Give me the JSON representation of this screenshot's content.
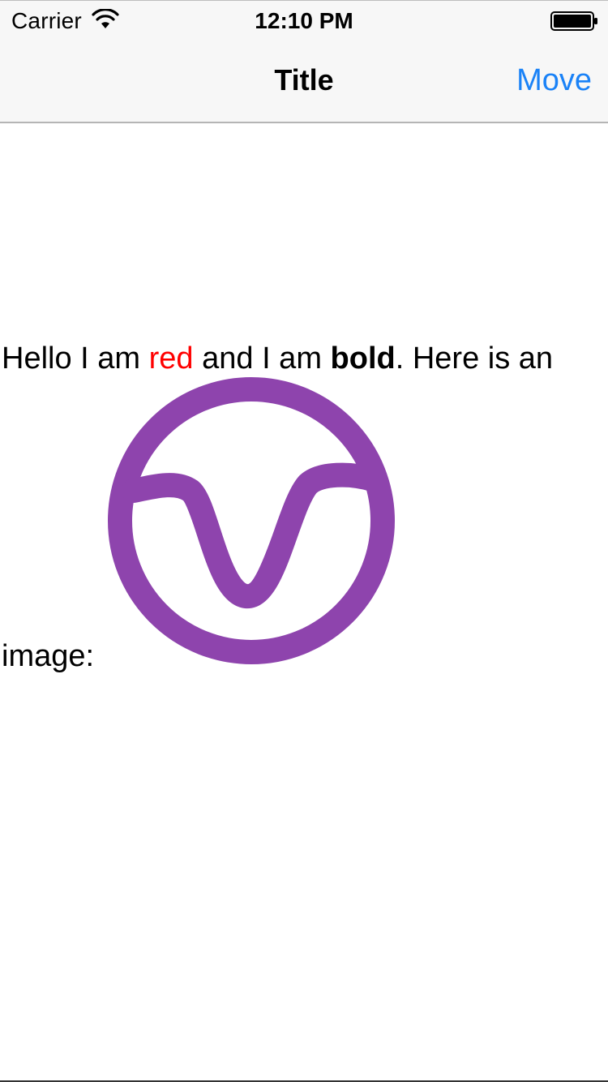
{
  "status_bar": {
    "carrier": "Carrier",
    "time": "12:10 PM",
    "wifi_icon": "wifi-icon",
    "battery_icon": "battery-icon"
  },
  "nav_bar": {
    "title": "Title",
    "right_button": "Move",
    "accent_color": "#1a82f7"
  },
  "body_text": {
    "part1": "Hello I am ",
    "red": "red",
    "part2": " and I am ",
    "bold": "bold",
    "part3": ". Here is an",
    "part4": "image:",
    "red_color": "#ff0000"
  },
  "image": {
    "icon": "purple-circle-logo-icon",
    "color": "#8e44ad"
  }
}
